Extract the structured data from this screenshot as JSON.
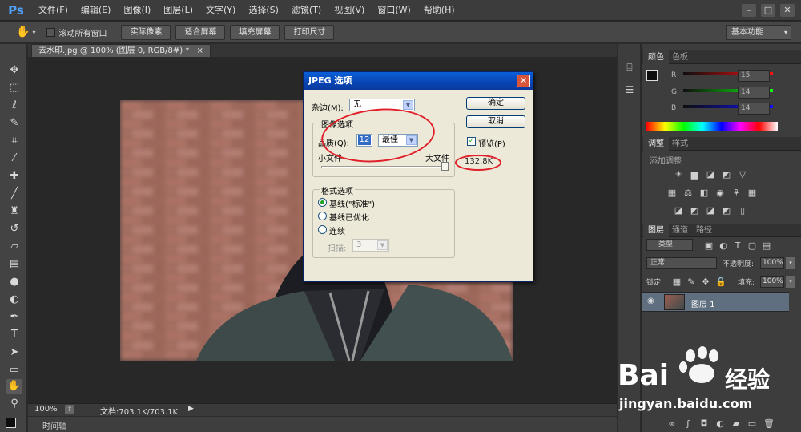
{
  "menubar": {
    "logo": "Ps",
    "items": [
      "文件(F)",
      "编辑(E)",
      "图像(I)",
      "图层(L)",
      "文字(Y)",
      "选择(S)",
      "滤镜(T)",
      "视图(V)",
      "窗口(W)",
      "帮助(H)"
    ],
    "window_controls": [
      "–",
      "□",
      "✕"
    ]
  },
  "optionsbar": {
    "scroll_all_label": "滚动所有窗口",
    "buttons": [
      "实际像素",
      "适合屏幕",
      "填充屏幕",
      "打印尺寸"
    ],
    "workspace": "基本功能"
  },
  "document": {
    "tab_title": "去水印.jpg @ 100% (图层 0, RGB/8#) *",
    "tab_close": "×",
    "zoom": "100%",
    "doc_info": "文档:703.1K/703.1K",
    "timeline": "时间轴"
  },
  "color_panel": {
    "tabs": [
      "颜色",
      "色板"
    ],
    "channels": [
      {
        "name": "R",
        "value": "15"
      },
      {
        "name": "G",
        "value": "14"
      },
      {
        "name": "B",
        "value": "14"
      }
    ]
  },
  "adjust_panel": {
    "tabs": [
      "调整",
      "样式"
    ],
    "hint": "添加调整"
  },
  "layers_panel": {
    "tabs": [
      "图层",
      "通道",
      "路径"
    ],
    "filter_kind": "类型",
    "blend_mode": "正常",
    "opacity_label": "不透明度:",
    "opacity_value": "100%",
    "lock_label": "锁定:",
    "fill_label": "填充:",
    "fill_value": "100%",
    "layer_name": "图层 1"
  },
  "dialog": {
    "title": "JPEG 选项",
    "matte_label": "杂边(M):",
    "matte_value": "无",
    "ok": "确定",
    "cancel": "取消",
    "preview_label": "预览(P)",
    "preview_checked": true,
    "image_options_group": "图像选项",
    "quality_label": "品质(Q):",
    "quality_value": "12",
    "quality_preset": "最佳",
    "small_file": "小文件",
    "large_file": "大文件",
    "file_size": "132.8K",
    "format_group": "格式选项",
    "formats": [
      {
        "label": "基线(\"标准\")",
        "selected": true
      },
      {
        "label": "基线已优化",
        "selected": false
      },
      {
        "label": "连续",
        "selected": false
      }
    ],
    "scans_label": "扫描:",
    "scans_value": "3"
  },
  "watermark": {
    "logo_text": "Bai",
    "logo_text2": "经验",
    "url": "jingyan.baidu.com"
  },
  "colors": {
    "ps_blue": "#4fa3ff",
    "annotation_red": "#e0202a",
    "xp_titlebar": "#0844b3"
  }
}
